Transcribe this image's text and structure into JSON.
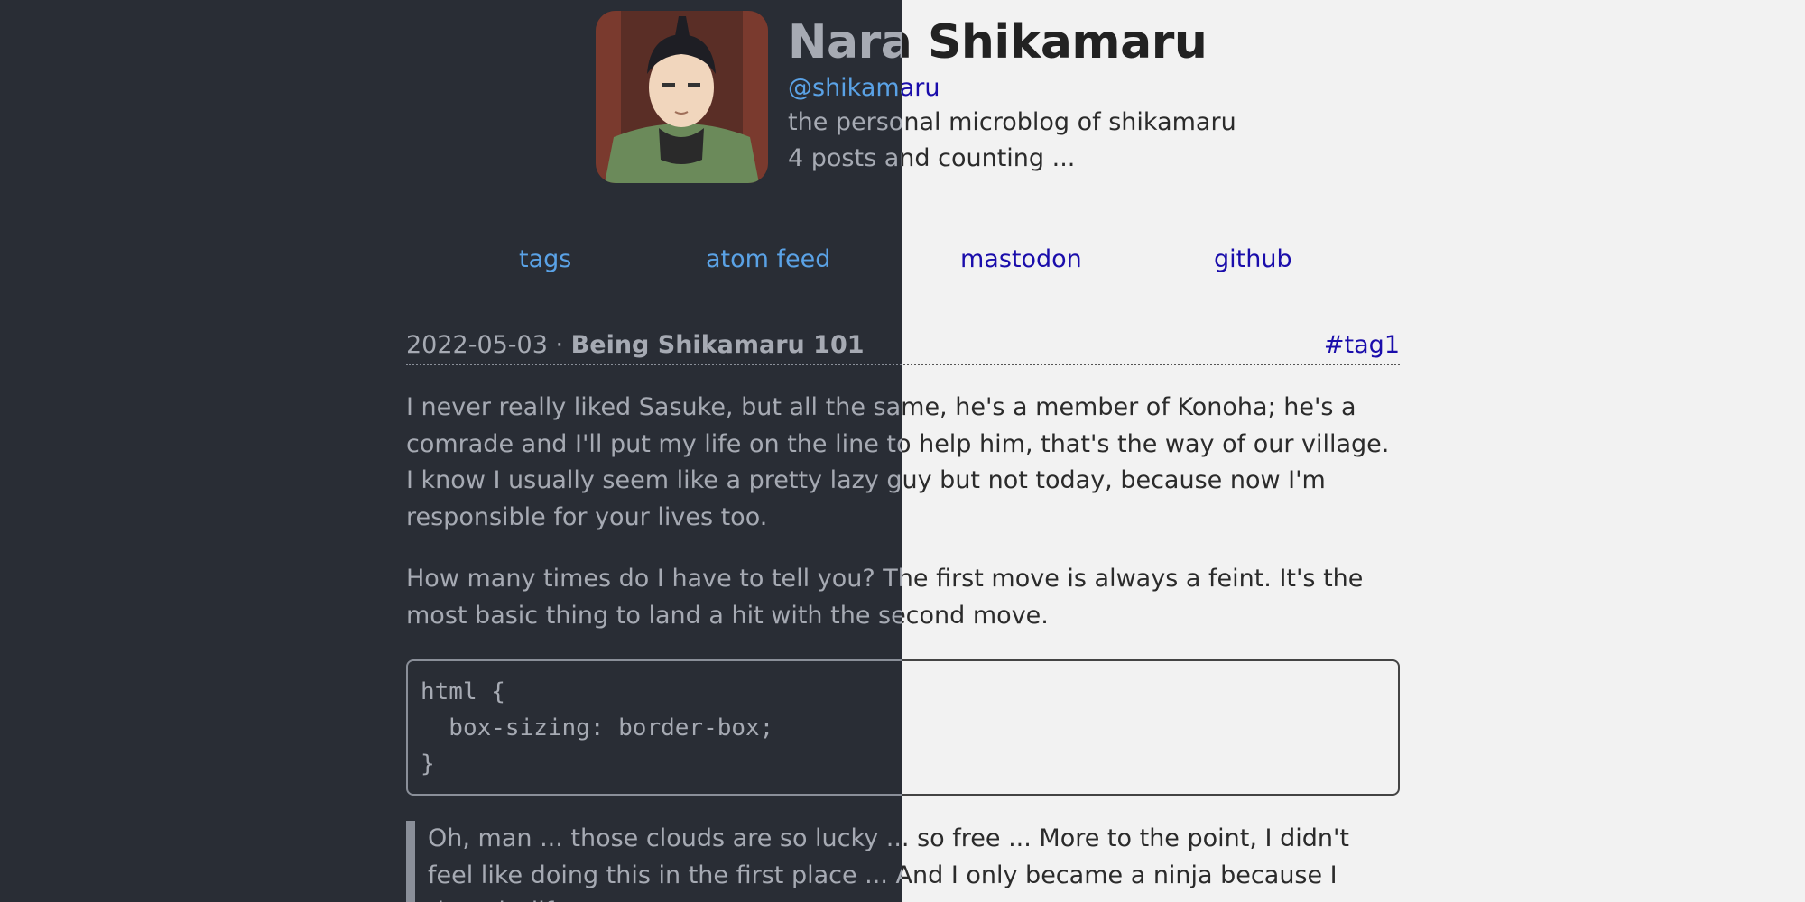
{
  "profile": {
    "name": "Nara Shikamaru",
    "handle": "@shikamaru",
    "description": "the personal microblog of shikamaru",
    "post_count": "4 posts and counting ..."
  },
  "nav": {
    "tags": "tags",
    "atom_feed": "atom feed",
    "mastodon": "mastodon",
    "github": "github"
  },
  "post": {
    "date": "2022-05-03",
    "separator": " · ",
    "title": "Being Shikamaru 101",
    "tag": "#tag1",
    "paragraph1": "I never really liked Sasuke, but all the same, he's a member of Konoha; he's a comrade and I'll put my life on the line to help him, that's the way of our village. I know I usually seem like a pretty lazy guy but not today, because now I'm responsible for your lives too.",
    "paragraph2": "How many times do I have to tell you? The first move is always a feint. It's the most basic thing to land a hit with the second move.",
    "code": "html {\n  box-sizing: border-box;\n}",
    "quote": "Oh, man ... those clouds are so lucky ... so free ... More to the point, I didn't feel like doing this in the first place ... And I only became a ninja because I thought life"
  },
  "colors": {
    "light_background": "#f2f2f2",
    "dark_background": "#292d35",
    "light_link": "#1a0dab",
    "dark_link": "#5aa2e6"
  }
}
